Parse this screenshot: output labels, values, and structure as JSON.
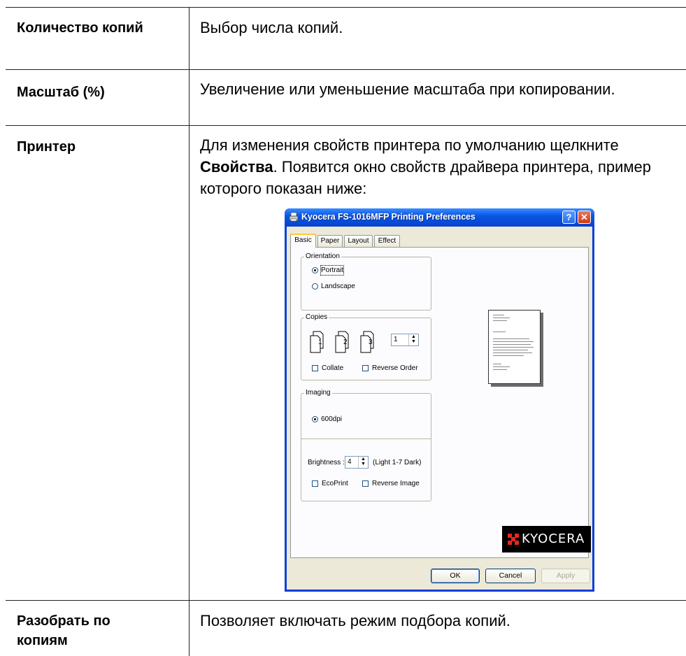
{
  "rows": [
    {
      "label": "Количество копий",
      "text": "Выбор числа копий."
    },
    {
      "label": "Масштаб (%)",
      "text": "Увеличение или уменьшение масштаба при копировании."
    },
    {
      "label": "Принтер",
      "text_before": "Для изменения свойств принтера по умолчанию щелкните ",
      "text_bold": "Свойства",
      "text_after": ". Появится окно свойств драйвера принтера, пример которого показан ниже:"
    },
    {
      "label": "Разобрать по копиям",
      "text": "Позволяет включать режим подбора копий."
    }
  ],
  "dialog": {
    "title": "Kyocera FS-1016MFP Printing Preferences",
    "help_label": "?",
    "close_label": "✕",
    "tabs": [
      "Basic",
      "Paper",
      "Layout",
      "Effect"
    ],
    "active_tab": "Basic",
    "orientation": {
      "title": "Orientation",
      "options": [
        "Portrait",
        "Landscape"
      ],
      "selected": "Portrait"
    },
    "copies": {
      "title": "Copies",
      "page_numbers": [
        "1",
        "2",
        "3"
      ],
      "value": "1",
      "collate_label": "Collate",
      "reverse_order_label": "Reverse Order",
      "collate": false,
      "reverse_order": false
    },
    "imaging": {
      "title": "Imaging",
      "resolution": "600dpi",
      "brightness_label": "Brightness :",
      "brightness_value": "4",
      "brightness_range": "(Light 1-7 Dark)",
      "ecoprint_label": "EcoPrint",
      "reverse_image_label": "Reverse Image",
      "ecoprint": false,
      "reverse_image": false
    },
    "logo_text": "KYOCERA",
    "buttons": {
      "ok": "OK",
      "cancel": "Cancel",
      "apply": "Apply"
    },
    "colors": {
      "titlebar": "#0a56e6",
      "face": "#ece9d8",
      "close": "#cc3a14",
      "logo_mark": "#e8261c"
    }
  }
}
